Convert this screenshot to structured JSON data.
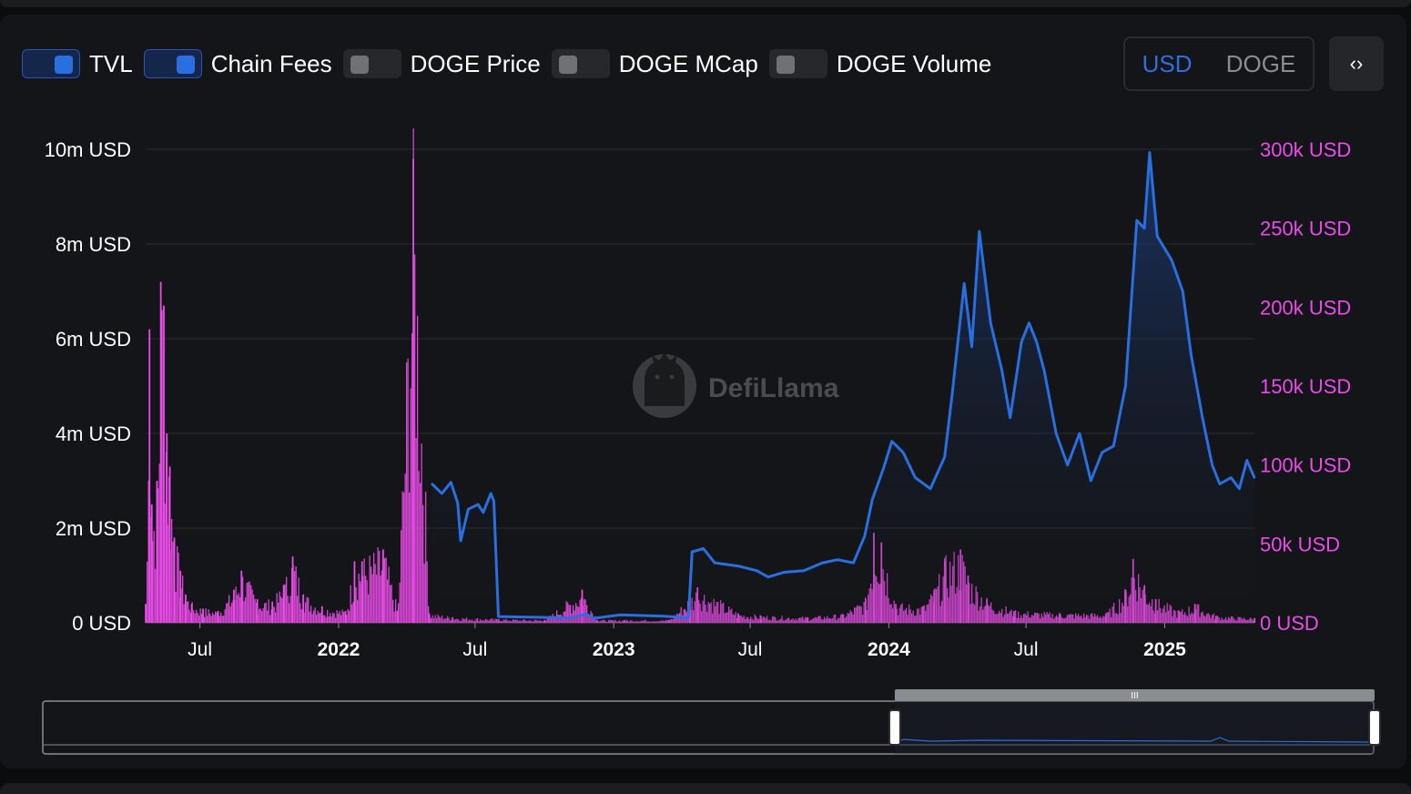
{
  "legend": {
    "toggles": [
      {
        "label": "TVL",
        "on": true
      },
      {
        "label": "Chain Fees",
        "on": true
      },
      {
        "label": "DOGE Price",
        "on": false
      },
      {
        "label": "DOGE MCap",
        "on": false
      },
      {
        "label": "DOGE Volume",
        "on": false
      }
    ]
  },
  "currency": {
    "usd_label": "USD",
    "doge_label": "DOGE",
    "selected": "USD"
  },
  "embed": {
    "icon": "code-icon",
    "glyph": "‹›"
  },
  "watermark": {
    "text": "DefiLlama"
  },
  "colors": {
    "tvl": "#2a6fe0",
    "fees": "#e94ce8",
    "left_axis": "#ffffff",
    "right_axis": "#e94ce8",
    "background": "#141518",
    "grid": "#2a2c31"
  },
  "chart_data": {
    "type": "line",
    "x_type": "date",
    "x_range": [
      "2021-04-20",
      "2025-04-30"
    ],
    "x_ticks": [
      {
        "date": "2021-07-01",
        "label": "Jul",
        "bold": false
      },
      {
        "date": "2022-01-01",
        "label": "2022",
        "bold": true
      },
      {
        "date": "2022-07-01",
        "label": "Jul",
        "bold": false
      },
      {
        "date": "2023-01-01",
        "label": "2023",
        "bold": true
      },
      {
        "date": "2023-07-01",
        "label": "Jul",
        "bold": false
      },
      {
        "date": "2024-01-01",
        "label": "2024",
        "bold": true
      },
      {
        "date": "2024-07-01",
        "label": "Jul",
        "bold": false
      },
      {
        "date": "2025-01-01",
        "label": "2025",
        "bold": true
      }
    ],
    "y_left": {
      "range": [
        0,
        10000000
      ],
      "ticks": [
        0,
        2000000,
        4000000,
        6000000,
        8000000,
        10000000
      ],
      "labels": [
        "0 USD",
        "2m USD",
        "4m USD",
        "6m USD",
        "8m USD",
        "10m USD"
      ]
    },
    "y_right": {
      "range": [
        0,
        300000
      ],
      "ticks": [
        0,
        50000,
        100000,
        150000,
        200000,
        250000,
        300000
      ],
      "labels": [
        "0 USD",
        "50k USD",
        "100k USD",
        "150k USD",
        "200k USD",
        "250k USD",
        "300k USD"
      ]
    },
    "grid": true,
    "series": [
      {
        "name": "TVL",
        "axis": "right",
        "style": "area-line",
        "points": [
          [
            "2022-05-05",
            88000
          ],
          [
            "2022-05-18",
            82000
          ],
          [
            "2022-05-30",
            89000
          ],
          [
            "2022-06-08",
            76000
          ],
          [
            "2022-06-12",
            52000
          ],
          [
            "2022-06-22",
            72000
          ],
          [
            "2022-07-05",
            75000
          ],
          [
            "2022-07-12",
            70000
          ],
          [
            "2022-07-22",
            82000
          ],
          [
            "2022-07-26",
            77000
          ],
          [
            "2022-08-01",
            4000
          ],
          [
            "2022-09-20",
            3500
          ],
          [
            "2022-11-01",
            3000
          ],
          [
            "2022-11-25",
            5500
          ],
          [
            "2022-12-05",
            2800
          ],
          [
            "2023-01-10",
            5000
          ],
          [
            "2023-03-10",
            4200
          ],
          [
            "2023-04-10",
            3000
          ],
          [
            "2023-04-15",
            45000
          ],
          [
            "2023-04-30",
            47000
          ],
          [
            "2023-05-15",
            38000
          ],
          [
            "2023-06-15",
            36000
          ],
          [
            "2023-07-10",
            33000
          ],
          [
            "2023-07-25",
            29000
          ],
          [
            "2023-08-15",
            32000
          ],
          [
            "2023-09-10",
            33000
          ],
          [
            "2023-10-05",
            38000
          ],
          [
            "2023-10-25",
            40000
          ],
          [
            "2023-11-15",
            38000
          ],
          [
            "2023-11-30",
            55000
          ],
          [
            "2023-12-10",
            78000
          ],
          [
            "2023-12-25",
            98000
          ],
          [
            "2024-01-05",
            115000
          ],
          [
            "2024-01-20",
            108000
          ],
          [
            "2024-02-05",
            92000
          ],
          [
            "2024-02-25",
            85000
          ],
          [
            "2024-03-15",
            105000
          ],
          [
            "2024-03-25",
            145000
          ],
          [
            "2024-04-10",
            215000
          ],
          [
            "2024-04-20",
            175000
          ],
          [
            "2024-04-30",
            248000
          ],
          [
            "2024-05-15",
            190000
          ],
          [
            "2024-05-30",
            160000
          ],
          [
            "2024-06-10",
            130000
          ],
          [
            "2024-06-25",
            178000
          ],
          [
            "2024-07-05",
            190000
          ],
          [
            "2024-07-15",
            178000
          ],
          [
            "2024-07-25",
            160000
          ],
          [
            "2024-08-10",
            120000
          ],
          [
            "2024-08-25",
            100000
          ],
          [
            "2024-09-10",
            120000
          ],
          [
            "2024-09-25",
            90000
          ],
          [
            "2024-10-10",
            108000
          ],
          [
            "2024-10-25",
            112000
          ],
          [
            "2024-11-10",
            150000
          ],
          [
            "2024-11-25",
            255000
          ],
          [
            "2024-12-05",
            250000
          ],
          [
            "2024-12-12",
            298000
          ],
          [
            "2024-12-22",
            245000
          ],
          [
            "2025-01-10",
            230000
          ],
          [
            "2025-01-25",
            210000
          ],
          [
            "2025-02-05",
            170000
          ],
          [
            "2025-02-20",
            130000
          ],
          [
            "2025-03-05",
            100000
          ],
          [
            "2025-03-15",
            88000
          ],
          [
            "2025-03-30",
            92000
          ],
          [
            "2025-04-10",
            85000
          ],
          [
            "2025-04-20",
            103000
          ],
          [
            "2025-04-30",
            92000
          ]
        ]
      },
      {
        "name": "Chain Fees",
        "axis": "left",
        "style": "bars",
        "points": [
          [
            "2021-04-20",
            400000
          ],
          [
            "2021-04-25",
            6200000
          ],
          [
            "2021-04-28",
            2500000
          ],
          [
            "2021-05-05",
            3000000
          ],
          [
            "2021-05-10",
            7200000
          ],
          [
            "2021-05-14",
            6700000
          ],
          [
            "2021-05-18",
            4000000
          ],
          [
            "2021-05-22",
            3300000
          ],
          [
            "2021-05-28",
            1800000
          ],
          [
            "2021-06-05",
            1100000
          ],
          [
            "2021-06-12",
            600000
          ],
          [
            "2021-06-20",
            400000
          ],
          [
            "2021-07-05",
            300000
          ],
          [
            "2021-07-25",
            250000
          ],
          [
            "2021-08-15",
            700000
          ],
          [
            "2021-08-25",
            1100000
          ],
          [
            "2021-09-15",
            500000
          ],
          [
            "2021-10-05",
            450000
          ],
          [
            "2021-10-20",
            800000
          ],
          [
            "2021-11-01",
            1400000
          ],
          [
            "2021-11-15",
            600000
          ],
          [
            "2021-12-10",
            350000
          ],
          [
            "2022-01-10",
            250000
          ],
          [
            "2022-01-22",
            1300000
          ],
          [
            "2022-02-01",
            1300000
          ],
          [
            "2022-03-01",
            1550000
          ],
          [
            "2022-03-20",
            250000
          ],
          [
            "2022-04-10",
            9800000
          ],
          [
            "2022-05-01",
            200000
          ],
          [
            "2022-06-01",
            120000
          ],
          [
            "2022-08-01",
            80000
          ],
          [
            "2022-10-01",
            60000
          ],
          [
            "2022-11-20",
            700000
          ],
          [
            "2022-12-10",
            60000
          ],
          [
            "2023-01-15",
            60000
          ],
          [
            "2023-03-15",
            60000
          ],
          [
            "2023-04-12",
            550000
          ],
          [
            "2023-04-22",
            750000
          ],
          [
            "2023-06-15",
            200000
          ],
          [
            "2023-07-15",
            150000
          ],
          [
            "2023-09-15",
            120000
          ],
          [
            "2023-11-01",
            180000
          ],
          [
            "2023-12-01",
            500000
          ],
          [
            "2023-12-12",
            1900000
          ],
          [
            "2023-12-22",
            1700000
          ],
          [
            "2024-01-10",
            400000
          ],
          [
            "2024-02-15",
            350000
          ],
          [
            "2024-03-01",
            700000
          ],
          [
            "2024-03-15",
            1300000
          ],
          [
            "2024-04-05",
            1550000
          ],
          [
            "2024-04-15",
            1000000
          ],
          [
            "2024-05-10",
            500000
          ],
          [
            "2024-06-15",
            250000
          ],
          [
            "2024-08-15",
            200000
          ],
          [
            "2024-10-15",
            200000
          ],
          [
            "2024-11-10",
            700000
          ],
          [
            "2024-11-20",
            1350000
          ],
          [
            "2024-12-05",
            800000
          ],
          [
            "2024-12-20",
            500000
          ],
          [
            "2025-01-20",
            250000
          ],
          [
            "2025-02-10",
            400000
          ],
          [
            "2025-03-10",
            150000
          ],
          [
            "2025-04-30",
            100000
          ]
        ]
      }
    ]
  },
  "brush": {
    "range_start_fraction": 0.64,
    "range_end_fraction": 1.0,
    "handle_label": "drag-handle"
  }
}
